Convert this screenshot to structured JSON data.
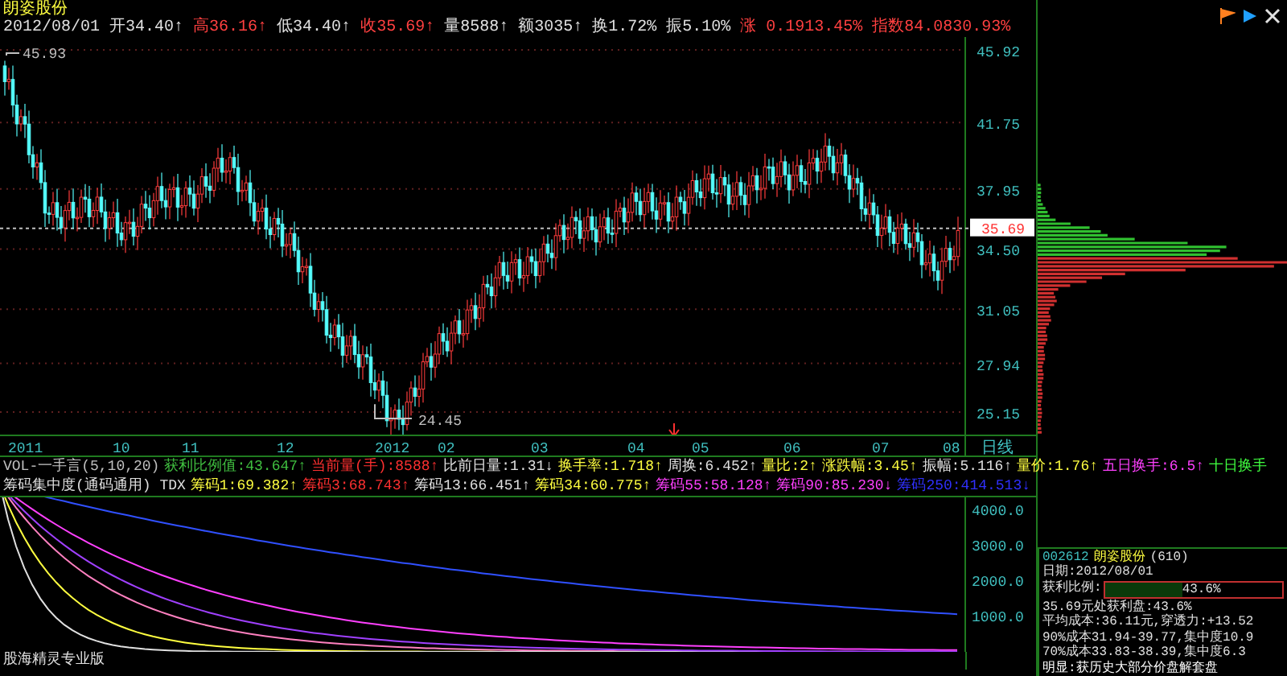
{
  "header": {
    "title": "朗姿股份",
    "items": [
      {
        "label": "2012/08/01",
        "color": "#e0e0e0"
      },
      {
        "label": "开34.40↑",
        "color": "#e0e0e0"
      },
      {
        "label": "高36.16↑",
        "color": "#ff4040"
      },
      {
        "label": "低34.40↑",
        "color": "#e0e0e0"
      },
      {
        "label": "收35.69↑",
        "color": "#ff4040"
      },
      {
        "label": "量8588↑",
        "color": "#e0e0e0"
      },
      {
        "label": "额3035↑",
        "color": "#e0e0e0"
      },
      {
        "label": "换1.72%",
        "color": "#e0e0e0"
      },
      {
        "label": "振5.10%",
        "color": "#e0e0e0"
      },
      {
        "label": "涨 0.1913.45%",
        "color": "#ff4040"
      },
      {
        "label": "指数84.0830.93%",
        "color": "#ff4040"
      }
    ]
  },
  "chart": {
    "high_label": "45.93",
    "low_label": "24.45",
    "current_price": "35.69",
    "price_axis": [
      "45.92",
      "41.75",
      "37.95",
      "34.50",
      "31.05",
      "27.94",
      "25.15"
    ],
    "date_axis": [
      "2011",
      "10",
      "11",
      "12",
      "2012",
      "02",
      "03",
      "04",
      "05",
      "06",
      "07",
      "08"
    ],
    "period": "日线"
  },
  "indicators": [
    {
      "items": [
        {
          "label": "VOL-一手言(5,10,20)",
          "color": "#c0c0c0"
        },
        {
          "label": "获利比例值:43.647↑",
          "color": "#40c040"
        },
        {
          "label": "当前量(手):8588↑",
          "color": "#ff3030"
        },
        {
          "label": "比前日量:1.31↓",
          "color": "#e0e0e0"
        },
        {
          "label": "换手率:1.718↑",
          "color": "#ffff40"
        },
        {
          "label": "周换:6.452↑",
          "color": "#e0e0e0"
        },
        {
          "label": "量比:2↑",
          "color": "#ffff40"
        },
        {
          "label": "涨跌幅:3.45↑",
          "color": "#ffff40"
        },
        {
          "label": "振幅:5.116↑",
          "color": "#e0e0e0"
        },
        {
          "label": "量价:1.76↑",
          "color": "#ffff40"
        },
        {
          "label": "五日换手:6.5↑",
          "color": "#ff40ff"
        },
        {
          "label": "十日换手",
          "color": "#40ff40"
        }
      ]
    },
    {
      "items": [
        {
          "label": "筹码集中度(通码通用) TDX",
          "color": "#e0e0e0"
        },
        {
          "label": "筹码1:69.382↑",
          "color": "#ffff40"
        },
        {
          "label": "筹码3:68.743↑",
          "color": "#ff3030"
        },
        {
          "label": "筹码13:66.451↑",
          "color": "#e0e0e0"
        },
        {
          "label": "筹码34:60.775↑",
          "color": "#ffff40"
        },
        {
          "label": "筹码55:58.128↑",
          "color": "#ff40ff"
        },
        {
          "label": "筹码90:85.230↓",
          "color": "#ff40ff"
        },
        {
          "label": "筹码250:414.513↓",
          "color": "#3030ff"
        }
      ]
    }
  ],
  "lower_axis": [
    "4000.0",
    "3000.0",
    "2000.0",
    "1000.0"
  ],
  "footer": {
    "label": "股海精灵专业版"
  },
  "info": {
    "code": "002612",
    "name": "朗姿股份",
    "count": "(610)",
    "date": "日期:2012/08/01",
    "ratio_label": "获利比例:",
    "ratio": {
      "level": 0.436,
      "reading": "43.6%"
    },
    "lines": [
      "35.69元处获利盘:43.6%",
      "平均成本:36.11元,穿透力:+13.52",
      "90%成本31.94-39.77,集中度10.9",
      "70%成本33.83-38.39,集中度6.3"
    ],
    "ticker": "明显:获历史大部分价盘解套盘"
  }
}
